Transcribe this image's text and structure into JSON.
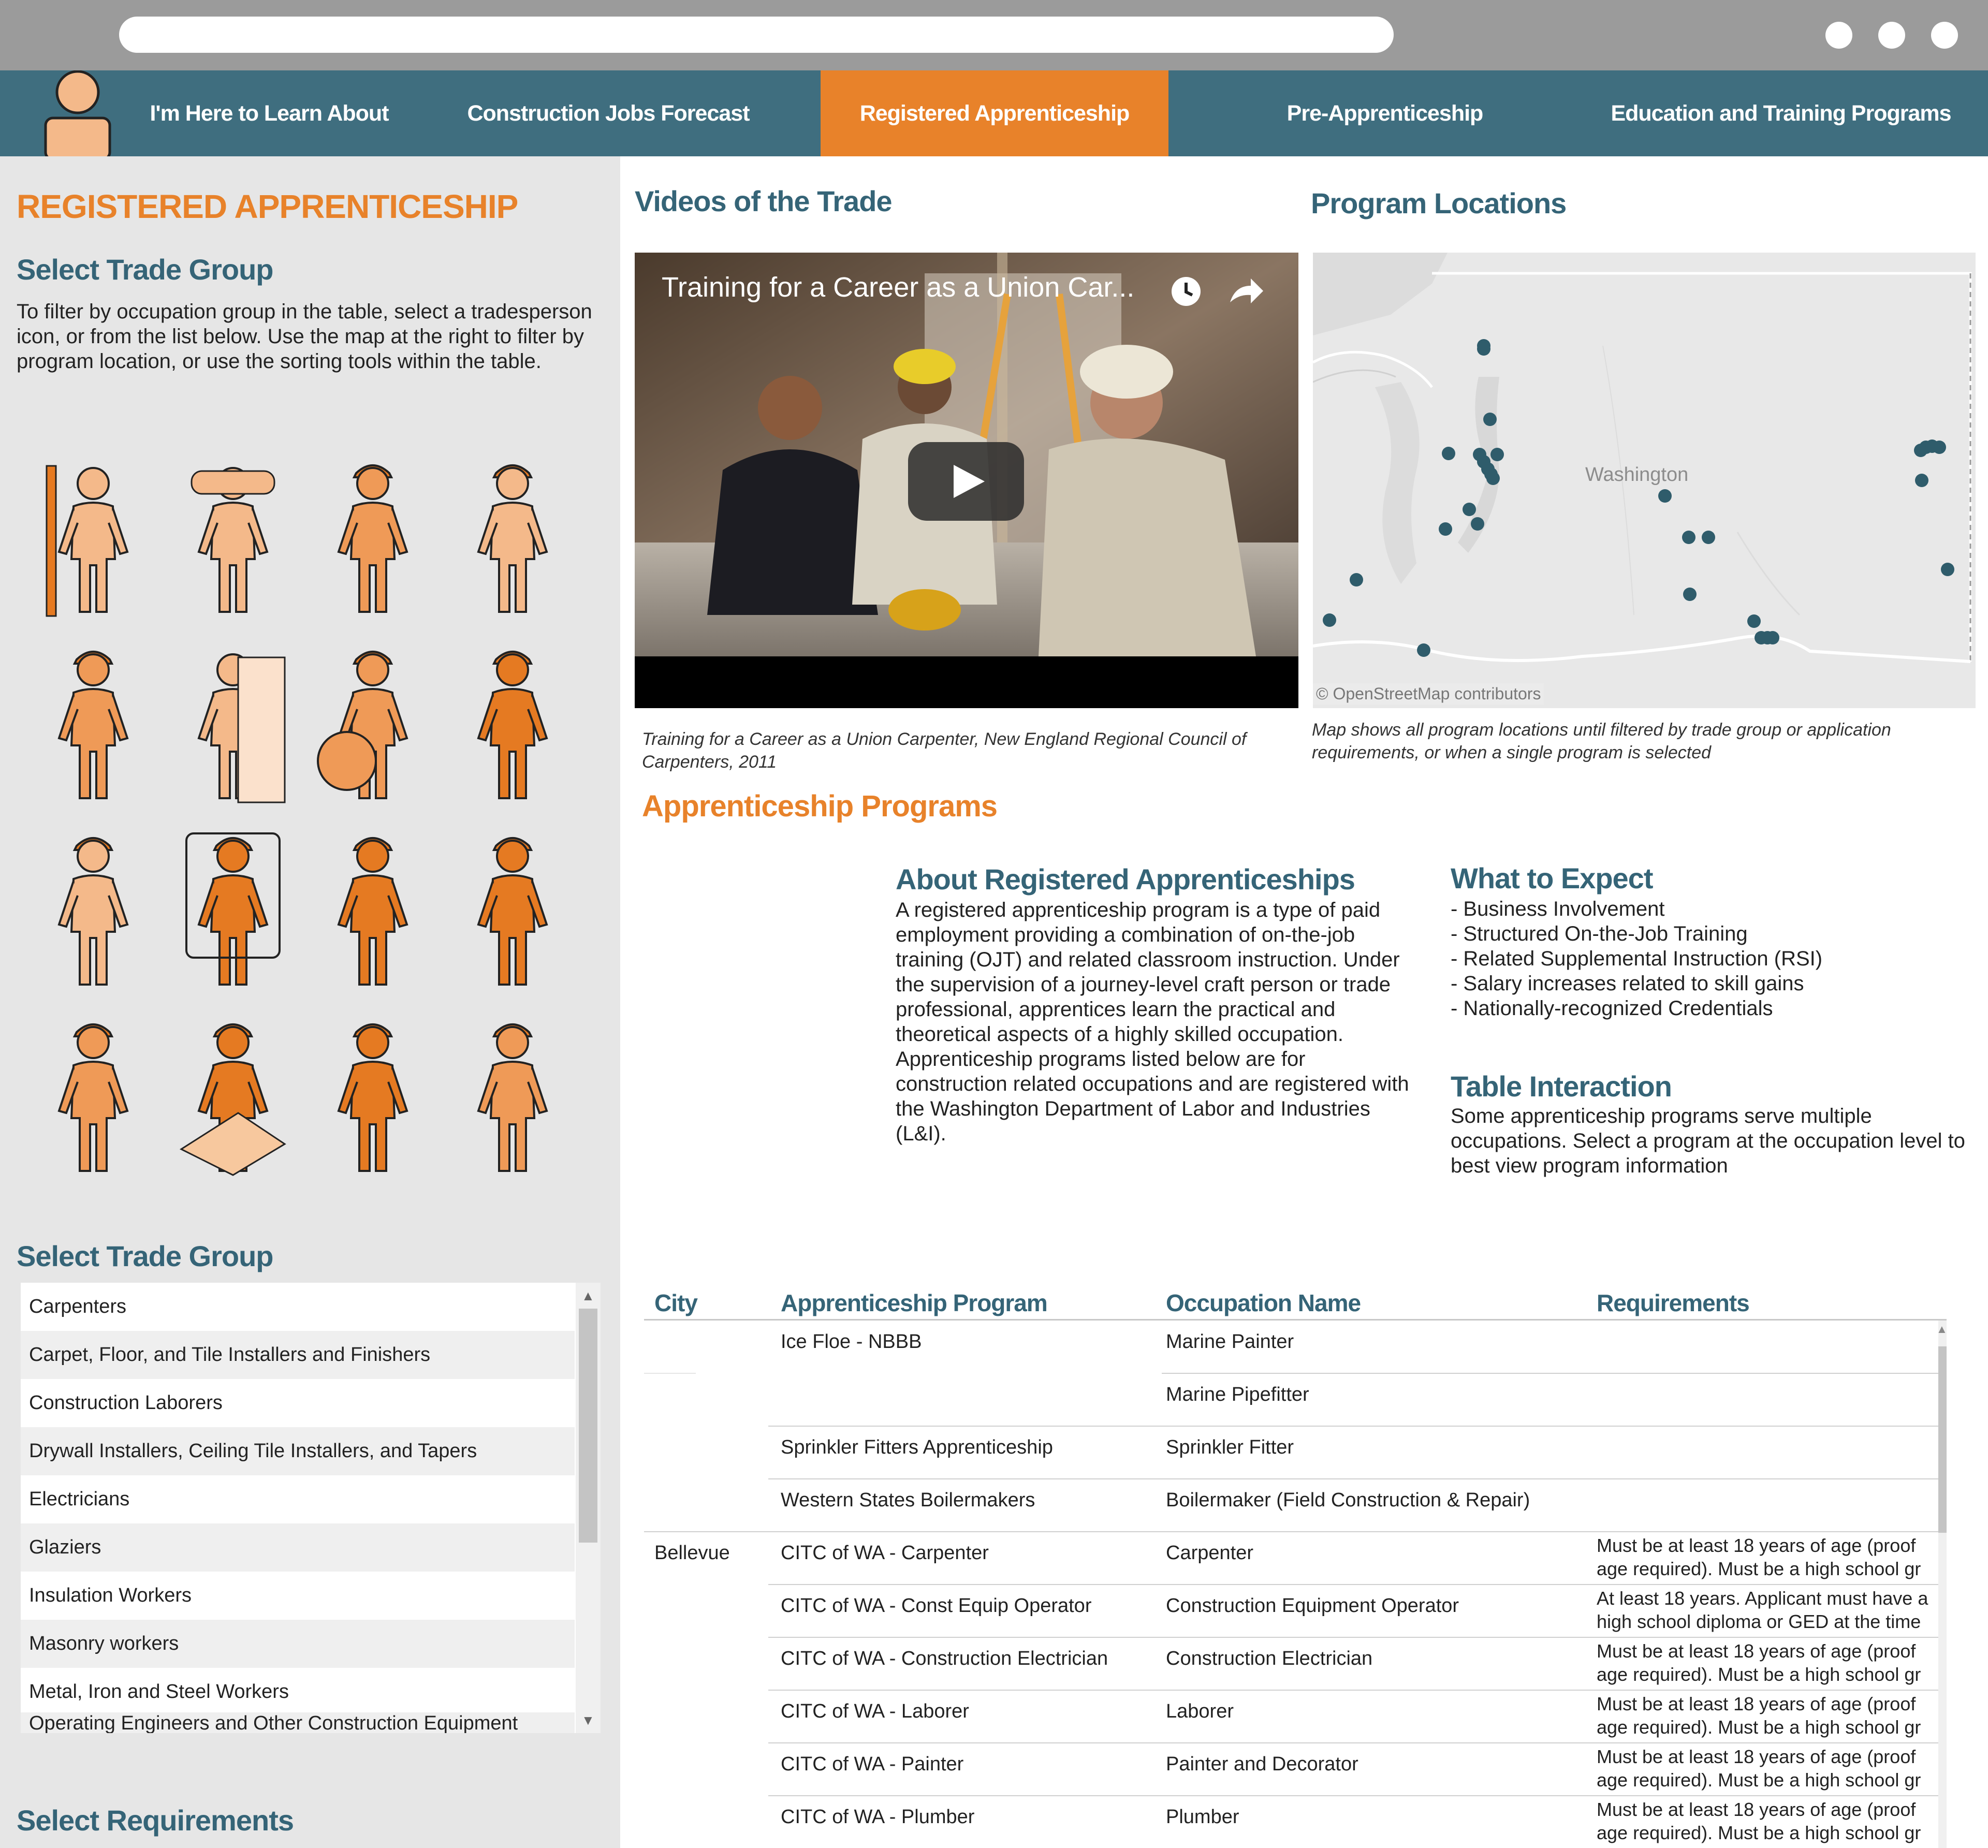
{
  "nav": {
    "items": [
      {
        "label": "I'm Here to Learn About"
      },
      {
        "label": "Construction Jobs Forecast"
      },
      {
        "label": "Registered Apprenticeship"
      },
      {
        "label": "Pre-Apprenticeship"
      },
      {
        "label": "Education and Training Programs"
      }
    ],
    "active_index": 2,
    "bg_color": "#3f6e7f",
    "active_color": "#e8822a"
  },
  "sidebar": {
    "title": "REGISTERED APPRENTICESHIP",
    "select_trade_heading": "Select Trade Group",
    "instructions": "To filter by occupation group in the table, select a tradesperson icon, or from the list below. Use the map at the right to filter by program location, or use the sorting tools within the table.",
    "icons": [
      "carpenter-icon",
      "pipefitter-icon",
      "laborer-icon",
      "drywall-installer-icon",
      "electrician-icon",
      "glazier-icon",
      "insulation-worker-icon",
      "mason-icon",
      "welder-icon",
      "operating-engineer-icon",
      "ironworker-icon",
      "painter-icon",
      "plumber-icon",
      "floor-installer-icon",
      "sheet-metal-worker-icon",
      "roofer-icon"
    ],
    "select_trade_heading_2": "Select Trade Group",
    "trade_list": [
      "Carpenters",
      "Carpet, Floor, and Tile Installers and Finishers",
      "Construction Laborers",
      "Drywall Installers, Ceiling Tile Installers, and Tapers",
      "Electricians",
      "Glaziers",
      "Insulation Workers",
      "Masonry workers",
      "Metal, Iron and Steel Workers",
      "Operating Engineers and Other Construction Equipment"
    ],
    "select_requirements_heading": "Select Requirements"
  },
  "videos": {
    "heading": "Videos of the Trade",
    "video_title": "Training for a Career as a Union Car...",
    "caption": "Training for a Career as a Union Carpenter, New England Regional Council of Carpenters, 2011"
  },
  "map": {
    "heading": "Program Locations",
    "state_label": "Washington",
    "attribution": "© OpenStreetMap contributors",
    "caption": "Map shows all program locations until filtered by trade group or application requirements, or when a single program is selected",
    "dot_color": "#2f5c6b"
  },
  "programs": {
    "heading": "Apprenticeship Programs",
    "about_heading": "About Registered Apprenticeships",
    "about_text": "A registered apprenticeship program is a type of paid employment providing a combination of on-the-job training (OJT) and related classroom instruction. Under the supervision of a journey-level craft person or trade professional, apprentices learn the practical and theoretical aspects of a highly skilled occupation. Apprenticeship programs listed below are for construction related occupations and are registered with the Washington Department of Labor and Industries (L&I).",
    "expect_heading": "What to Expect",
    "expect_items": [
      "- Business Involvement",
      "- Structured On-the-Job Training",
      "- Related Supplemental Instruction (RSI)",
      "- Salary increases related to skill gains",
      "- Nationally-recognized Credentials"
    ],
    "interaction_heading": "Table Interaction",
    "interaction_text": "Some apprenticeship programs serve multiple occupations. Select a program at the occupation level to best view program information"
  },
  "table": {
    "headers": [
      "City",
      "Apprenticeship Program",
      "Occupation Name",
      "Requirements"
    ],
    "rows": [
      {
        "city": "",
        "program": "Ice Floe - NBBB",
        "occupation": "Marine Painter",
        "req1": "",
        "req2": ""
      },
      {
        "city": "",
        "program": "",
        "occupation": "Marine Pipefitter",
        "req1": "",
        "req2": ""
      },
      {
        "city": "",
        "program": "Sprinkler Fitters Apprenticeship",
        "occupation": "Sprinkler Fitter",
        "req1": "",
        "req2": ""
      },
      {
        "city": "",
        "program": "Western States Boilermakers",
        "occupation": "Boilermaker (Field Construction & Repair)",
        "req1": "",
        "req2": ""
      },
      {
        "city": "Bellevue",
        "program": "CITC of WA - Carpenter",
        "occupation": "Carpenter",
        "req1": "Must be at least 18 years of age (proof",
        "req2": "age required). Must be a high school gr"
      },
      {
        "city": "",
        "program": "CITC of WA - Const Equip Operator",
        "occupation": "Construction Equipment Operator",
        "req1": "At least 18 years. Applicant must have a",
        "req2": "high school diploma or GED at the time"
      },
      {
        "city": "",
        "program": "CITC of WA - Construction Electrician",
        "occupation": "Construction Electrician",
        "req1": "Must be at least 18 years of age (proof",
        "req2": "age required). Must be a high school gr"
      },
      {
        "city": "",
        "program": "CITC of WA - Laborer",
        "occupation": "Laborer",
        "req1": "Must be at least 18 years of age (proof",
        "req2": "age required). Must be a high school gr"
      },
      {
        "city": "",
        "program": "CITC of WA - Painter",
        "occupation": "Painter and Decorator",
        "req1": "Must be at least 18 years of age (proof",
        "req2": "age required). Must be a high school gr"
      },
      {
        "city": "",
        "program": "CITC of WA - Plumber",
        "occupation": "Plumber",
        "req1": "Must be at least 18 years of age (proof",
        "req2": "age required). Must be a high school gr"
      }
    ]
  },
  "colors": {
    "orange": "#e8822a",
    "teal": "#356477",
    "icon_light": "#f4b98a",
    "icon_mid": "#ef9a57",
    "icon_dark": "#e57a22"
  }
}
